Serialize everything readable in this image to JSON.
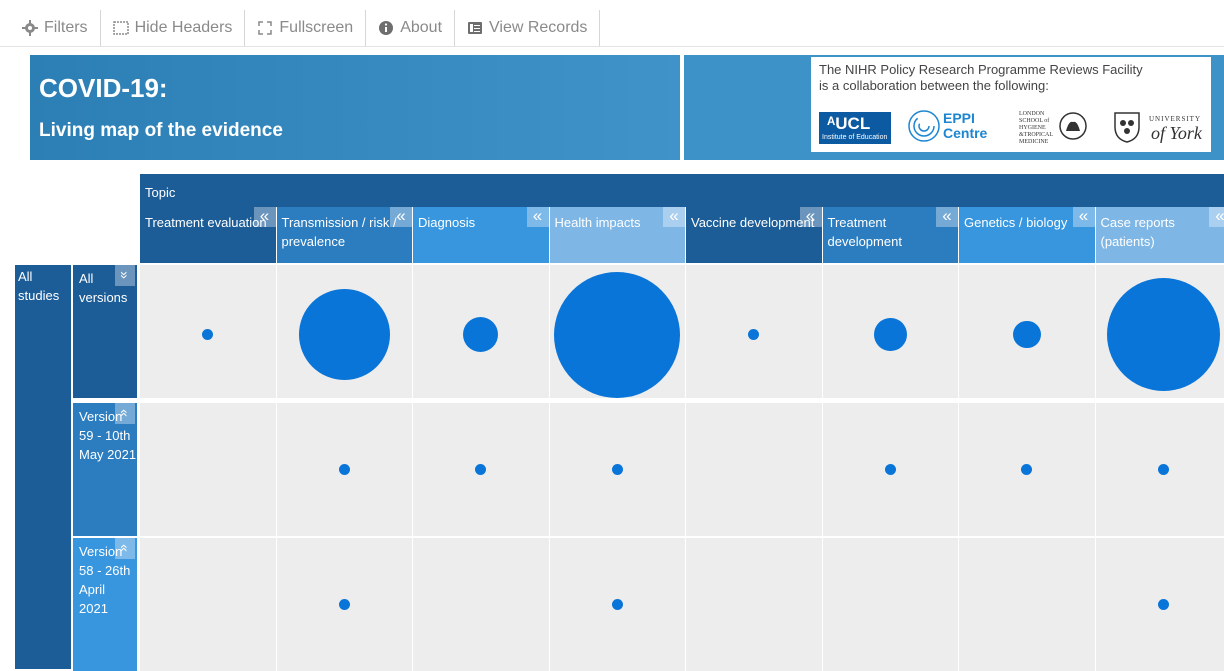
{
  "toolbar": {
    "filters": "Filters",
    "hide_headers": "Hide Headers",
    "fullscreen": "Fullscreen",
    "about": "About",
    "view_records": "View Records"
  },
  "banner": {
    "title": "COVID-19:",
    "subtitle": "Living map of the evidence",
    "partner_text_1": "The NIHR Policy Research Programme Reviews Facility",
    "partner_text_2": "is a collaboration between the following:",
    "ucl_big": "ᴬUCL",
    "ucl_small": "Institute of Education",
    "eppi_1": "EPPI",
    "eppi_2": "Centre",
    "lshtm_lines": [
      "LONDON",
      "SCHOOL of",
      "HYGIENE",
      "&TROPICAL",
      "MEDICINE"
    ],
    "york_univ": "UNIVERSITY",
    "york_of": "of York"
  },
  "grid": {
    "topic_label": "Topic",
    "all_studies": "All studies",
    "columns": [
      "Treatment evaluation",
      "Transmission / risk / prevalence",
      "Diagnosis",
      "Health impacts",
      "Vaccine development",
      "Treatment development",
      "Genetics / biology",
      "Case reports (patients)"
    ],
    "column_colors": [
      "#1c5d98",
      "#2b7dc0",
      "#3896de",
      "#7eb6e6",
      "#1c5d98",
      "#2b7dc0",
      "#3896de",
      "#7eb6e6"
    ],
    "rows": [
      {
        "label": "All versions",
        "color": "#1c5d98",
        "icon": "chevron-down-icon"
      },
      {
        "label": "Version 59 - 10th May 2021",
        "color": "#2b7dc0",
        "icon": "chevron-up-icon"
      },
      {
        "label": "Version 58 - 26th April 2021",
        "color": "#3896de",
        "icon": "chevron-up-icon"
      }
    ],
    "bubble_levels": [
      [
        0.08,
        0.72,
        0.28,
        1.0,
        0.08,
        0.26,
        0.22,
        0.9
      ],
      [
        0,
        0.08,
        0.08,
        0.08,
        0,
        0.08,
        0.08,
        0.08
      ],
      [
        0,
        0.08,
        0,
        0.08,
        0,
        0,
        0,
        0.08
      ]
    ],
    "bubble_color": "#0a75d8"
  }
}
